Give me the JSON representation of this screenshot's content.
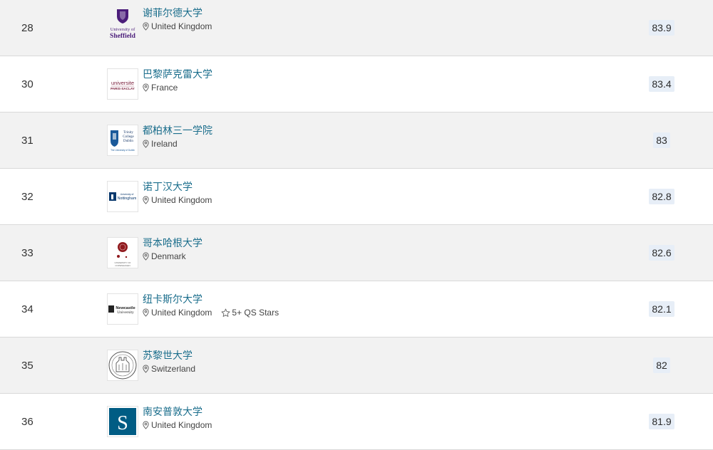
{
  "rows": [
    {
      "rank": "28",
      "name": "谢菲尔德大学",
      "country": "United Kingdom",
      "score": "83.9",
      "logo_text": [
        "University of",
        "Sheffield"
      ],
      "logo_icon": "sheffield-crest-logo"
    },
    {
      "rank": "30",
      "name": "巴黎萨克雷大学",
      "country": "France",
      "score": "83.4",
      "logo_text": [
        "universite",
        "PARIS-SACLAY"
      ],
      "logo_icon": "paris-saclay-logo"
    },
    {
      "rank": "31",
      "name": "都柏林三一学院",
      "country": "Ireland",
      "score": "83",
      "logo_text": [
        "Trinity",
        "College",
        "Dublin",
        "The University of Dublin"
      ],
      "logo_icon": "trinity-college-logo"
    },
    {
      "rank": "32",
      "name": "诺丁汉大学",
      "country": "United Kingdom",
      "score": "82.8",
      "logo_text": [
        "University of",
        "Nottingham"
      ],
      "logo_icon": "nottingham-logo"
    },
    {
      "rank": "33",
      "name": "哥本哈根大学",
      "country": "Denmark",
      "score": "82.6",
      "logo_text": [
        "UNIVERSITY OF",
        "COPENHAGEN"
      ],
      "logo_icon": "copenhagen-seal-logo"
    },
    {
      "rank": "34",
      "name": "纽卡斯尔大学",
      "country": "United Kingdom",
      "score": "82.1",
      "stars": "5+ QS Stars",
      "logo_text": [
        "Newcastle",
        "University"
      ],
      "logo_icon": "newcastle-logo"
    },
    {
      "rank": "35",
      "name": "苏黎世大学",
      "country": "Switzerland",
      "score": "82",
      "logo_text": [],
      "logo_icon": "zurich-seal-logo"
    },
    {
      "rank": "36",
      "name": "南安普敦大学",
      "country": "United Kingdom",
      "score": "81.9",
      "logo_text": [
        "S"
      ],
      "logo_icon": "southampton-logo"
    }
  ],
  "colors": {
    "link": "#1b6e8c",
    "score_bg": "#e7eef7",
    "row_alt": "#f2f2f2",
    "accent": "#f5c34a"
  },
  "icons": {
    "location": "location-pin-icon",
    "star": "star-outline-icon"
  }
}
